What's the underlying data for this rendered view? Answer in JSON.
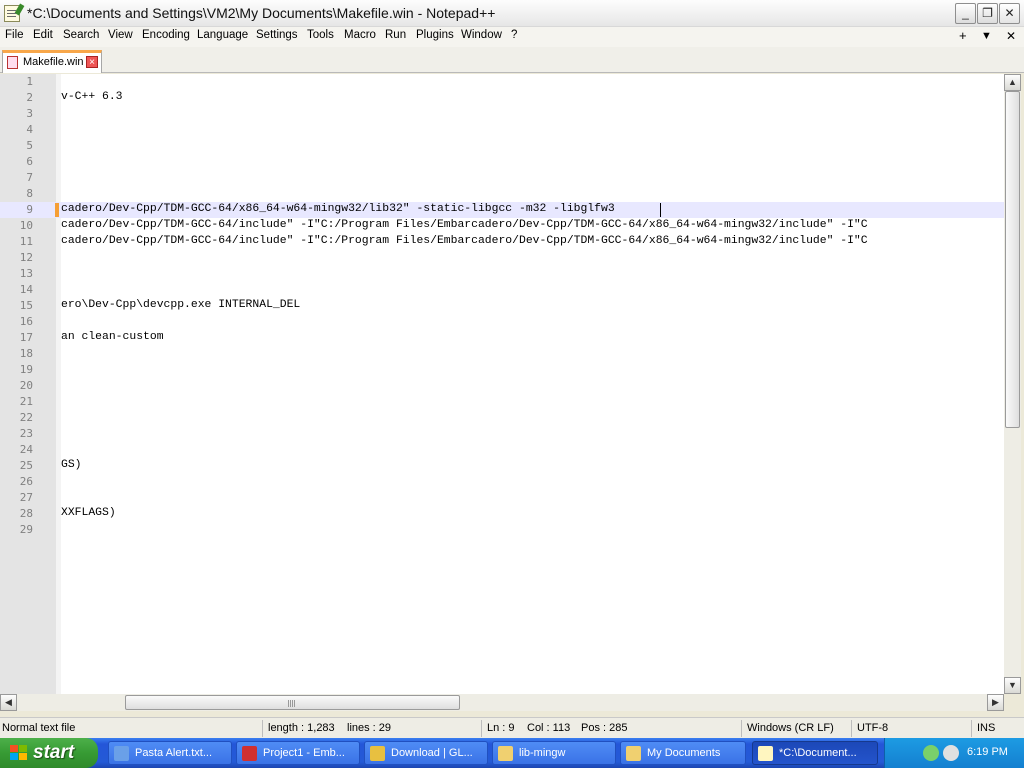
{
  "window": {
    "title": "*C:\\Documents and Settings\\VM2\\My Documents\\Makefile.win - Notepad++",
    "minimize_label": "_",
    "restore_label": "❐",
    "close_label": "✕"
  },
  "menu": {
    "items": [
      "File",
      "Edit",
      "Search",
      "View",
      "Encoding",
      "Language",
      "Settings",
      "Tools",
      "Macro",
      "Run",
      "Plugins",
      "Window",
      "?"
    ],
    "right": [
      "+",
      "▼",
      "✕"
    ]
  },
  "tab": {
    "label": "Makefile.win",
    "close_label": "×"
  },
  "editor": {
    "current_line": 9,
    "lines": [
      {
        "n": "1",
        "text": ""
      },
      {
        "n": "2",
        "text": "v-C++ 6.3"
      },
      {
        "n": "3",
        "text": ""
      },
      {
        "n": "4",
        "text": ""
      },
      {
        "n": "5",
        "text": ""
      },
      {
        "n": "6",
        "text": ""
      },
      {
        "n": "7",
        "text": ""
      },
      {
        "n": "8",
        "text": ""
      },
      {
        "n": "9",
        "text": "cadero/Dev-Cpp/TDM-GCC-64/x86_64-w64-mingw32/lib32\" -static-libgcc -m32 -libglfw3"
      },
      {
        "n": "10",
        "text": "cadero/Dev-Cpp/TDM-GCC-64/include\" -I\"C:/Program Files/Embarcadero/Dev-Cpp/TDM-GCC-64/x86_64-w64-mingw32/include\" -I\"C"
      },
      {
        "n": "11",
        "text": "cadero/Dev-Cpp/TDM-GCC-64/include\" -I\"C:/Program Files/Embarcadero/Dev-Cpp/TDM-GCC-64/x86_64-w64-mingw32/include\" -I\"C"
      },
      {
        "n": "12",
        "text": ""
      },
      {
        "n": "13",
        "text": ""
      },
      {
        "n": "14",
        "text": ""
      },
      {
        "n": "15",
        "text": "ero\\Dev-Cpp\\devcpp.exe INTERNAL_DEL"
      },
      {
        "n": "16",
        "text": ""
      },
      {
        "n": "17",
        "text": "an clean-custom"
      },
      {
        "n": "18",
        "text": ""
      },
      {
        "n": "19",
        "text": ""
      },
      {
        "n": "20",
        "text": ""
      },
      {
        "n": "21",
        "text": ""
      },
      {
        "n": "22",
        "text": ""
      },
      {
        "n": "23",
        "text": ""
      },
      {
        "n": "24",
        "text": ""
      },
      {
        "n": "25",
        "text": "GS)"
      },
      {
        "n": "26",
        "text": ""
      },
      {
        "n": "27",
        "text": ""
      },
      {
        "n": "28",
        "text": "XXFLAGS)"
      },
      {
        "n": "29",
        "text": ""
      }
    ]
  },
  "scrollbars": {
    "up": "▲",
    "down": "▼",
    "left": "◀",
    "right": "▶"
  },
  "status": {
    "file_type": "Normal text file",
    "length": "length : 1,283",
    "lines": "lines : 29",
    "ln": "Ln : 9",
    "col": "Col : 113",
    "pos": "Pos : 285",
    "eol": "Windows (CR LF)",
    "encoding": "UTF-8",
    "mode": "INS"
  },
  "taskbar": {
    "start_label": "start",
    "tasks": [
      {
        "label": "Pasta Alert.txt...",
        "icon_color": "#6aa0e8"
      },
      {
        "label": "Project1 - Emb...",
        "icon_color": "#d03030"
      },
      {
        "label": "Download | GL...",
        "icon_color": "#e8c040"
      },
      {
        "label": "lib-mingw",
        "icon_color": "#f0d070"
      },
      {
        "label": "My Documents",
        "icon_color": "#f0d070"
      },
      {
        "label": "*C:\\Document...",
        "icon_color": "#fff6c0"
      }
    ],
    "clock": "6:19 PM"
  }
}
